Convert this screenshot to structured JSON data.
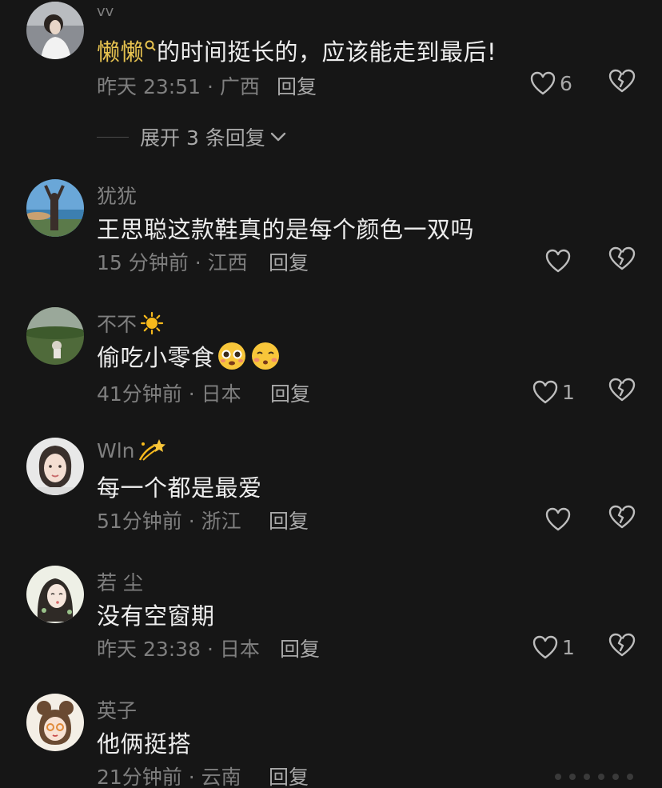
{
  "comments": [
    {
      "username": "vv",
      "content_highlight": "懒懒",
      "content": "的时间挺长的，应该能走到最后!",
      "meta": "昨天 23:51 · 广西",
      "reply_label": "回复",
      "likes": "6",
      "expand_label": "展开 3 条回复"
    },
    {
      "username": "犹犹",
      "content": "王思聪这款鞋真的是每个颜色一双吗",
      "meta": "15 分钟前 · 江西",
      "reply_label": "回复",
      "likes": ""
    },
    {
      "username": "不不",
      "content": "偷吃小零食",
      "meta": "41分钟前 · 日本",
      "reply_label": "回复",
      "likes": "1"
    },
    {
      "username": "Wln",
      "content": "每一个都是最爱",
      "meta": "51分钟前 · 浙江",
      "reply_label": "回复",
      "likes": ""
    },
    {
      "username": "若 尘",
      "content": "没有空窗期",
      "meta": "昨天 23:38 · 日本",
      "reply_label": "回复",
      "likes": "1"
    },
    {
      "username": "英子",
      "content": "他俩挺搭",
      "meta": "21分钟前 · 云南",
      "reply_label": "回复",
      "likes": ""
    }
  ],
  "colors": {
    "background": "#161616",
    "text_primary": "#ededed",
    "text_secondary": "#7f7f7f",
    "highlight": "#e6c250"
  },
  "icons": {
    "like": "heart-outline-icon",
    "dislike": "broken-heart-icon",
    "expand": "chevron-down-icon",
    "search_badge": "search-icon",
    "sun": "sun-emoji",
    "sparkle": "dizzy-emoji"
  }
}
